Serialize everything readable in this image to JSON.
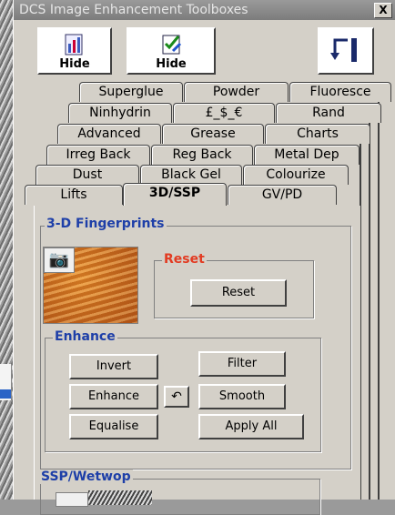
{
  "window": {
    "title": "DCS Image Enhancement Toolboxes",
    "close_label": "X"
  },
  "toolbar": {
    "hide1_label": "Hide",
    "hide2_label": "Hide"
  },
  "tabs": {
    "row1": [
      "Superglue",
      "Powder",
      "Fluoresce"
    ],
    "row2": [
      "Ninhydrin",
      "£_$_€",
      "Rand"
    ],
    "row3": [
      "Advanced",
      "Grease",
      "Charts"
    ],
    "row4": [
      "Irreg Back",
      "Reg Back",
      "Metal Dep"
    ],
    "row5": [
      "Dust",
      "Black Gel",
      "Colourize"
    ],
    "row6": [
      "Lifts",
      "3D/SSP",
      "GV/PD"
    ],
    "active": "3D/SSP"
  },
  "panel": {
    "fingerprints": {
      "title": "3-D Fingerprints",
      "camera_icon": "camera-icon"
    },
    "reset_group": {
      "title": "Reset",
      "button": "Reset"
    },
    "enhance_group": {
      "title": "Enhance",
      "invert": "Invert",
      "filter": "Filter",
      "enhance": "Enhance",
      "undo_icon": "undo-icon",
      "smooth": "Smooth",
      "equalise": "Equalise",
      "apply_all": "Apply All"
    },
    "ssp": {
      "title": "SSP/Wetwop"
    }
  },
  "colors": {
    "group_label": "#1e3fa8",
    "reset_label": "#e23b22",
    "title_bg": "#8a8a8a"
  }
}
